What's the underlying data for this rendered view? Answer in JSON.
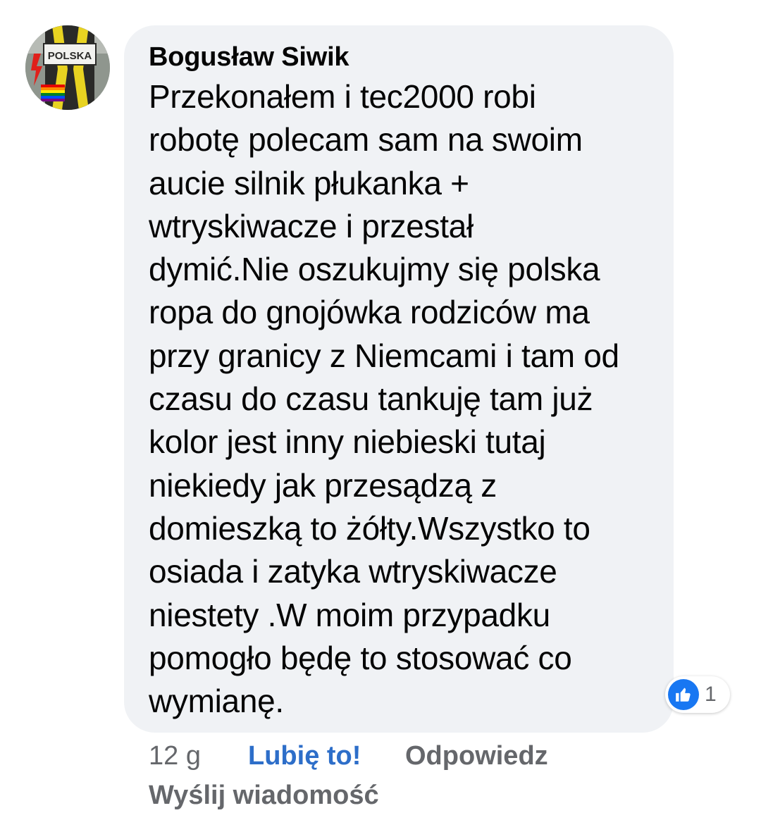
{
  "comment": {
    "author": "Bogusław Siwik",
    "lines": [
      "Przekonałem i tec2000 robi",
      "robotę polecam sam na swoim",
      "aucie silnik płukanka +",
      "wtryskiwacze i przestał",
      "dymić.Nie oszukujmy się polska",
      "ropa do gnojówka rodziców ma",
      "przy granicy z Niemcami i tam od",
      "czasu do czasu tankuję tam już",
      "kolor jest inny niebieski tutaj",
      "niekiedy jak przesądzą z",
      "domieszką to żółty.Wszystko to",
      "osiada i zatyka wtryskiwacze",
      "niestety .W moim przypadku",
      "pomogło będę to stosować co",
      "wymianę."
    ],
    "avatar_text": "POLSKA",
    "reaction": {
      "icon": "thumbs-up-icon",
      "count": "1",
      "color": "#1877f2"
    },
    "timestamp": "12 g",
    "like_label": "Lubię to!",
    "reply_label": "Odpowiedz",
    "send_message_label": "Wyślij wiadomość"
  }
}
